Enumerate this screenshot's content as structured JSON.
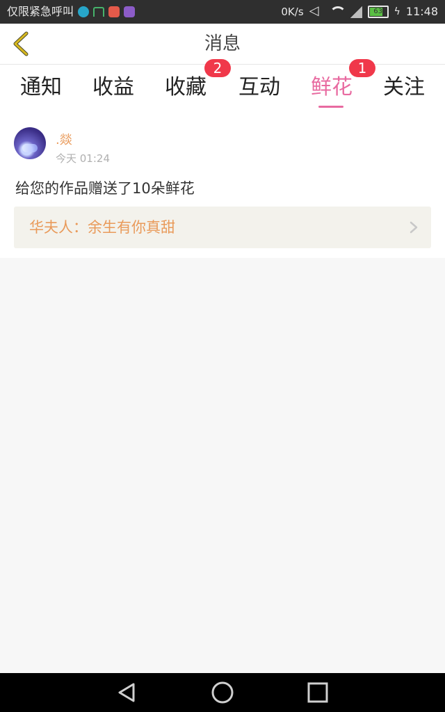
{
  "status_bar": {
    "carrier": "仅限紧急呼叫",
    "speed": "0K/s",
    "battery": "63",
    "time": "11:48",
    "icons": [
      "moon-icon",
      "android-icon",
      "app-red-icon",
      "app-purple-icon",
      "mute-icon",
      "wifi-icon",
      "signal-icon",
      "battery-icon",
      "charging-icon"
    ]
  },
  "header": {
    "title": "消息",
    "back_icon": "chevron-left-icon"
  },
  "tabs": [
    {
      "label": "通知",
      "badge": ""
    },
    {
      "label": "收益",
      "badge": ""
    },
    {
      "label": "收藏",
      "badge": "2"
    },
    {
      "label": "互动",
      "badge": ""
    },
    {
      "label": "鲜花",
      "badge": "1",
      "active": true
    },
    {
      "label": "关注",
      "badge": ""
    }
  ],
  "notification": {
    "username": ".燚",
    "time": "今天 01:24",
    "message": "给您的作品赠送了10朵鲜花",
    "work_title": "华夫人：余生有你真甜"
  },
  "colors": {
    "accent_pink": "#e86aa0",
    "badge_red": "#f0384a",
    "highlight_orange": "#e99a5a",
    "back_icon_yellow": "#d7b81f"
  },
  "nav_bar": {
    "icons": [
      "back-triangle-icon",
      "home-circle-icon",
      "recents-square-icon"
    ]
  }
}
